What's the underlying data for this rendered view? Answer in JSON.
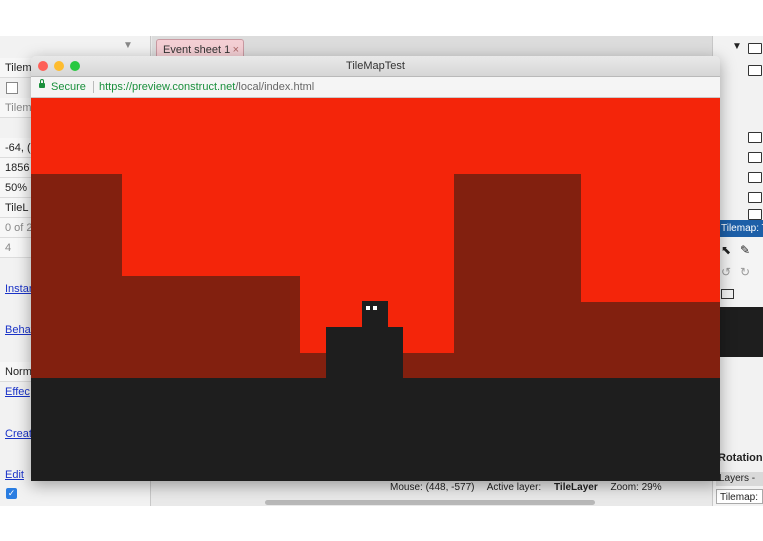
{
  "browser": {
    "title": "TileMapTest",
    "secure_label": "Secure",
    "url_host": "https://preview.construct.net",
    "url_path": "/local/index.html",
    "traffic_lights": {
      "close": "#fe5f57",
      "minimize": "#febc2e",
      "zoom": "#28c840"
    }
  },
  "editor": {
    "tab_label": "Event sheet 1",
    "tab_close": "×",
    "scroll_indicator": "▼",
    "left_panel": {
      "rows": [
        "Tilem",
        "Tilem",
        "-64, (",
        "1856",
        "50%",
        "TileL",
        "0 of 2",
        "4",
        "Norm"
      ],
      "links": [
        "Instar",
        "Behav",
        "Effec",
        "Creat",
        "Edit"
      ],
      "checkbox_checked": true
    },
    "status": {
      "mouse": "Mouse: (448, -577)",
      "active_layer_label": "Active layer:",
      "active_layer_value": "TileLayer",
      "zoom": "Zoom: 29%"
    },
    "right_panel": {
      "tree_arrow": "▼",
      "tilemap_header": "Tilemap: T",
      "tools": [
        "⬉",
        "✎",
        "↺",
        "↻"
      ],
      "rotation_label": "Rotation",
      "layers_tab": "Layers -",
      "tilemap_tab": "Tilemap:"
    }
  },
  "colors": {
    "sky": "#f4250a",
    "hill": "#82200f",
    "ground": "#1e1e1e",
    "url_secure": "#1a8f3c",
    "tab_bg": "#f4cfd4"
  }
}
